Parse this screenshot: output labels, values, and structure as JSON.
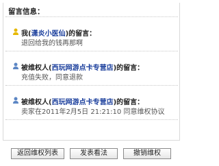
{
  "header": "留言信息：",
  "messages": [
    {
      "icon": "user-warning-icon",
      "prefix": "我(",
      "name": "潇炎小医仙",
      "suffix": ")的留言：",
      "text": "退回给我的钱再那啊"
    },
    {
      "icon": "user-icon",
      "prefix": "被维权人(",
      "name": "西玩网游点卡专营店",
      "suffix": ")的留言：",
      "text": "充值失败，同意退款"
    },
    {
      "icon": "user-icon",
      "prefix": "被维权人(",
      "name": "西玩网游点卡专营店",
      "suffix": ")的留言：",
      "text": "卖家在2011年2月5日 21:21:10 同意维权协议"
    }
  ],
  "buttons": {
    "back": "返回维权列表",
    "post": "发表看法",
    "cancel": "撤销维权"
  }
}
